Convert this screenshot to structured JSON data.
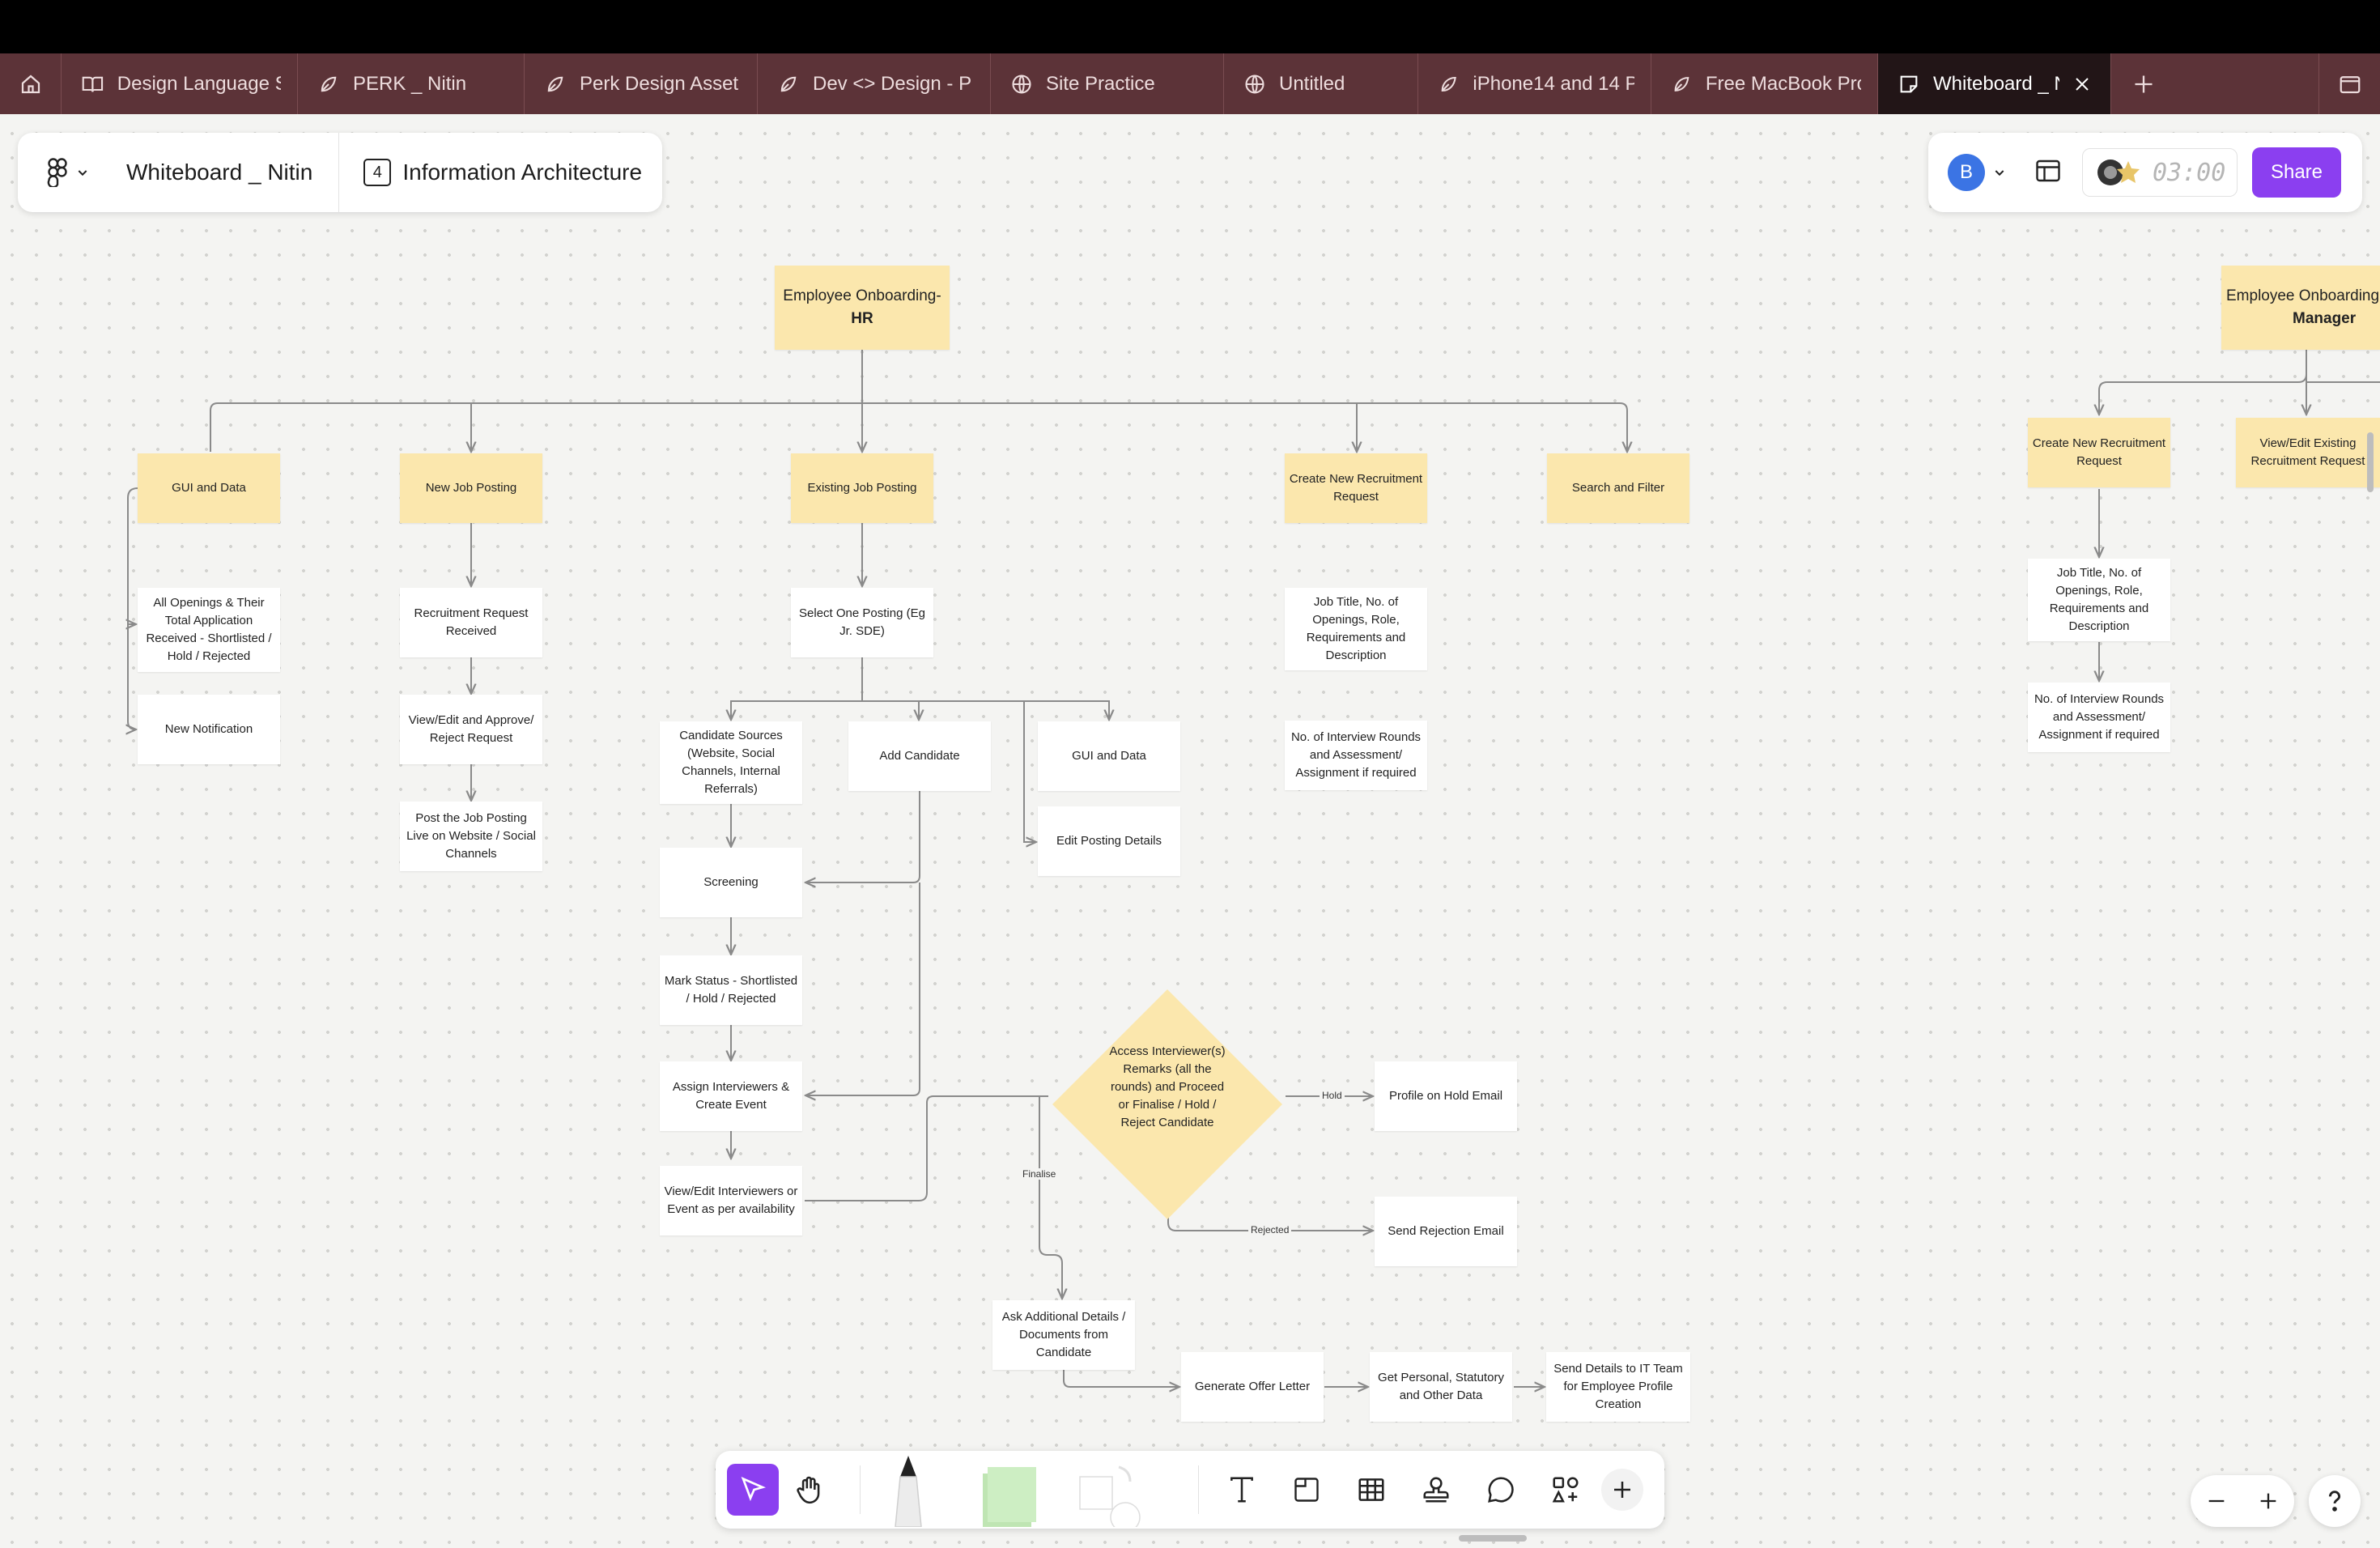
{
  "tabs": [
    {
      "icon": "book-icon",
      "label": "Design Language S"
    },
    {
      "icon": "figjam-icon",
      "label": "PERK _ Nitin"
    },
    {
      "icon": "figjam-icon",
      "label": "Perk Design Asset"
    },
    {
      "icon": "figjam-icon",
      "label": "Dev <> Design - P"
    },
    {
      "icon": "globe-icon",
      "label": "Site Practice"
    },
    {
      "icon": "globe-icon",
      "label": "Untitled"
    },
    {
      "icon": "figjam-icon",
      "label": "iPhone14 and 14 P"
    },
    {
      "icon": "figjam-icon",
      "label": "Free MacBook Pro"
    },
    {
      "icon": "whiteboard-icon",
      "label": "Whiteboard _ N"
    }
  ],
  "header": {
    "file_title": "Whiteboard _ Nitin",
    "page_number": "4",
    "page_name": "Information Architecture"
  },
  "collab": {
    "avatar": "B",
    "timer": "03:00",
    "share": "Share"
  },
  "nodes": {
    "hr_root": "Employee Onboarding-",
    "hr_root_bold": "HR",
    "gui_data": "GUI and Data",
    "new_job": "New Job Posting",
    "existing_job": "Existing Job Posting",
    "create_req": "Create New Recruitment Request",
    "search_filter": "Search and Filter",
    "all_openings": "All Openings & Their Total Application Received - Shortlisted / Hold / Rejected",
    "new_notification": "New Notification",
    "req_received": "Recruitment Request Received",
    "view_edit_approve": "View/Edit and Approve/ Reject Request",
    "post_live": "Post the Job Posting Live on Website / Social Channels",
    "select_posting": "Select One Posting (Eg Jr. SDE)",
    "candidate_sources": "Candidate Sources (Website, Social Channels, Internal Referrals)",
    "add_candidate": "Add Candidate",
    "gui_data_2": "GUI and Data",
    "edit_posting": "Edit Posting Details",
    "screening": "Screening",
    "mark_status": "Mark Status - Shortlisted / Hold / Rejected",
    "assign_interviewers": "Assign Interviewers & Create Event",
    "view_edit_interviewers": "View/Edit Interviewers or Event as per availability",
    "job_title": "Job Title, No. of Openings, Role, Requirements and Description",
    "interview_rounds": "No. of Interview Rounds and Assessment/ Assignment if required",
    "access_remarks": "Access Interviewer(s) Remarks (all the rounds) and Proceed or Finalise / Hold / Reject Candidate",
    "profile_hold": "Profile on Hold Email",
    "rejection_email": "Send Rejection Email",
    "ask_details": "Ask Additional Details / Documents from Candidate",
    "offer_letter": "Generate Offer Letter",
    "personal_data": "Get Personal, Statutory and Other Data",
    "it_team": "Send Details to IT Team for Employee Profile Creation",
    "mgr_root": "Employee Onboarding -",
    "mgr_root_bold": "Manager",
    "mgr_create_req": "Create New Recruitment Request",
    "mgr_view_edit": "View/Edit Existing Recruitment Request",
    "mgr_job_title": "Job Title, No. of Openings, Role, Requirements and Description",
    "mgr_interview_rounds": "No. of Interview Rounds and Assessment/ Assignment if required"
  },
  "edge_labels": {
    "hold": "Hold",
    "finalise": "Finalise",
    "rejected": "Rejected"
  },
  "colors": {
    "tab_bar": "#5c3338",
    "sticky": "#fbe7ad",
    "accent": "#8b3ff0"
  }
}
